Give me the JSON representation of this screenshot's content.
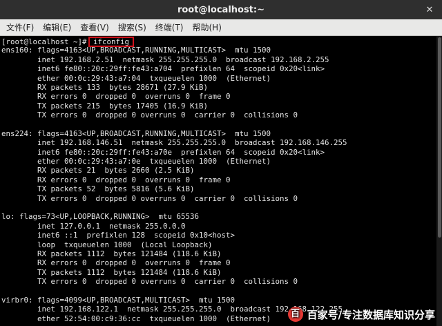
{
  "window": {
    "title": "root@localhost:~",
    "close_glyph": "✕"
  },
  "menu": [
    {
      "label": "文件(F)"
    },
    {
      "label": "编辑(E)"
    },
    {
      "label": "查看(V)"
    },
    {
      "label": "搜索(S)"
    },
    {
      "label": "终端(T)"
    },
    {
      "label": "帮助(H)"
    }
  ],
  "terminal": {
    "prompt": "[root@localhost ~]# ",
    "command": "ifconfig",
    "output": [
      "ens160: flags=4163<UP,BROADCAST,RUNNING,MULTICAST>  mtu 1500",
      "        inet 192.168.2.51  netmask 255.255.255.0  broadcast 192.168.2.255",
      "        inet6 fe80::20c:29ff:fe43:a704  prefixlen 64  scopeid 0x20<link>",
      "        ether 00:0c:29:43:a7:04  txqueuelen 1000  (Ethernet)",
      "        RX packets 133  bytes 28671 (27.9 KiB)",
      "        RX errors 0  dropped 0  overruns 0  frame 0",
      "        TX packets 215  bytes 17405 (16.9 KiB)",
      "        TX errors 0  dropped 0 overruns 0  carrier 0  collisions 0",
      "",
      "ens224: flags=4163<UP,BROADCAST,RUNNING,MULTICAST>  mtu 1500",
      "        inet 192.168.146.51  netmask 255.255.255.0  broadcast 192.168.146.255",
      "        inet6 fe80::20c:29ff:fe43:a70e  prefixlen 64  scopeid 0x20<link>",
      "        ether 00:0c:29:43:a7:0e  txqueuelen 1000  (Ethernet)",
      "        RX packets 21  bytes 2660 (2.5 KiB)",
      "        RX errors 0  dropped 0  overruns 0  frame 0",
      "        TX packets 52  bytes 5816 (5.6 KiB)",
      "        TX errors 0  dropped 0 overruns 0  carrier 0  collisions 0",
      "",
      "lo: flags=73<UP,LOOPBACK,RUNNING>  mtu 65536",
      "        inet 127.0.0.1  netmask 255.0.0.0",
      "        inet6 ::1  prefixlen 128  scopeid 0x10<host>",
      "        loop  txqueuelen 1000  (Local Loopback)",
      "        RX packets 1112  bytes 121484 (118.6 KiB)",
      "        RX errors 0  dropped 0  overruns 0  frame 0",
      "        TX packets 1112  bytes 121484 (118.6 KiB)",
      "        TX errors 0  dropped 0 overruns 0  carrier 0  collisions 0",
      "",
      "virbr0: flags=4099<UP,BROADCAST,MULTICAST>  mtu 1500",
      "        inet 192.168.122.1  netmask 255.255.255.0  broadcast 192.168.122.255",
      "        ether 52:54:00:c9:36:cc  txqueuelen 1000  (Ethernet)"
    ]
  },
  "watermark": {
    "text": "百家号/专注数据库知识分享",
    "logo_glyph": "百"
  },
  "colors": {
    "highlight_box": "#d0121b",
    "terminal_bg": "#000000",
    "terminal_fg": "#e6e6e6"
  }
}
